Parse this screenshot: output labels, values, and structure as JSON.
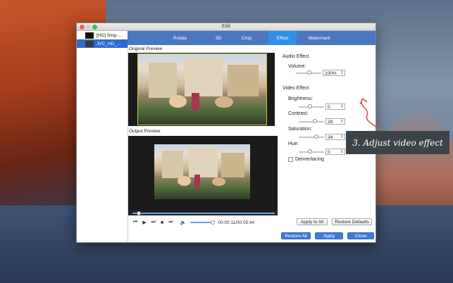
{
  "window": {
    "title": "Edit"
  },
  "files": [
    {
      "name": "[HD] Sing-..."
    },
    {
      "name": "JVC_HD_..."
    }
  ],
  "tabs": [
    "Rotate",
    "3D",
    "Crop",
    "Effect",
    "Watermark"
  ],
  "active_tab": "Effect",
  "preview": {
    "original_label": "Original Preview",
    "output_label": "Output Preview",
    "time": "00:00:11/00:05:44"
  },
  "audio": {
    "section": "Audio Effect",
    "volume_label": "Volume:",
    "volume_value": "100%"
  },
  "video": {
    "section": "Video Effect",
    "brightness_label": "Brightness:",
    "brightness_value": "0",
    "contrast_label": "Contrast:",
    "contrast_value": "29",
    "saturation_label": "Saturation:",
    "saturation_value": "34",
    "hue_label": "Hue:",
    "hue_value": "0",
    "deinterlacing_label": "Deinterlacing"
  },
  "buttons": {
    "apply_to_all": "Apply to All",
    "restore_defaults": "Restore Defaults",
    "restore_all": "Restore All",
    "apply": "Apply",
    "close": "Close"
  },
  "annotation": "3. Adjust video effect",
  "colors": {
    "accent": "#4a77bf",
    "active_tab": "#2d8fe8",
    "selection": "#2f6ad2",
    "annotation_arrow": "#d9534f"
  }
}
